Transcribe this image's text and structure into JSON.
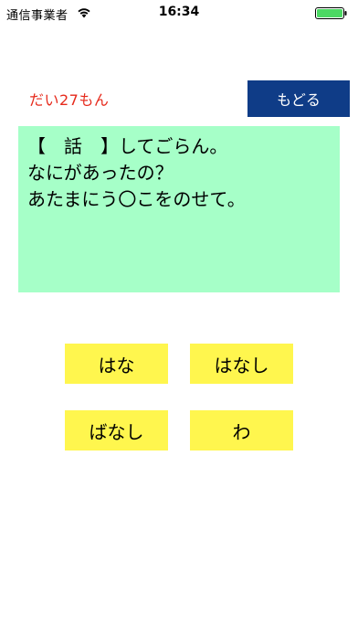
{
  "status_bar": {
    "carrier": "通信事業者",
    "time": "16:34",
    "wifi_icon": "wifi-icon",
    "battery_icon": "battery-full-icon",
    "battery_color": "#4cd964"
  },
  "header": {
    "question_number": "だい27もん",
    "back_label": "もどる"
  },
  "question": {
    "lines": [
      "【　話　】してごらん。",
      "なにがあったの？",
      "あたまにう〇こをのせて。"
    ]
  },
  "answers": [
    "はな",
    "はなし",
    "ばなし",
    "わ"
  ],
  "colors": {
    "question_number": "#e62a1c",
    "back_button": "#0f3c87",
    "question_panel": "#a6ffc8",
    "answer_button": "#fff64e"
  }
}
